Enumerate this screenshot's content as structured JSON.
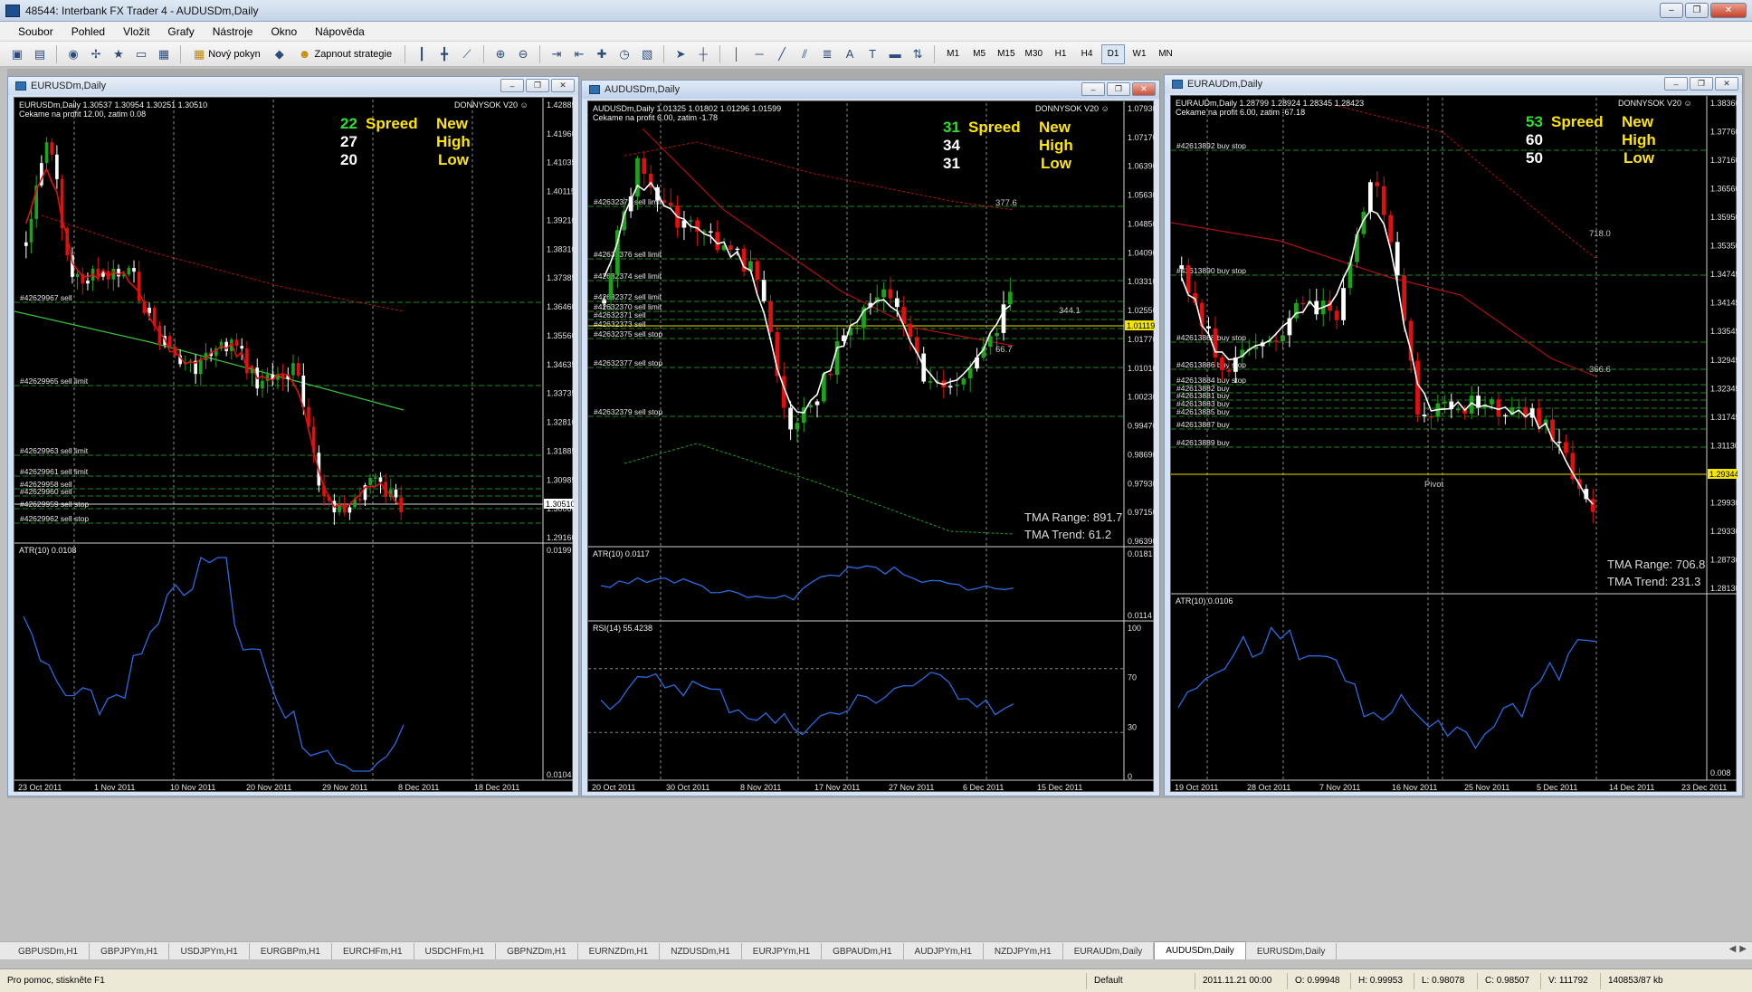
{
  "app": {
    "title": "48544: Interbank FX Trader 4 - AUDUSDm,Daily"
  },
  "window_buttons": {
    "minimize": "–",
    "restore": "❐",
    "close": "✕"
  },
  "menu": [
    "Soubor",
    "Pohled",
    "Vložit",
    "Grafy",
    "Nástroje",
    "Okno",
    "Nápověda"
  ],
  "toolbar": {
    "new_order": "Nový pokyn",
    "strategies": "Zapnout strategie",
    "timeframes": [
      "M1",
      "M5",
      "M15",
      "M30",
      "H1",
      "H4",
      "D1",
      "W1",
      "MN"
    ],
    "active_timeframe": "D1"
  },
  "charts": [
    {
      "window_title": "EURUSDm,Daily",
      "info_line1": "EURUSDm,Daily  1.30537 1.30954 1.30251 1.30510",
      "info_line2": "Cekame na profit 12.00, zatim 0.08",
      "brand": "DONNYSOK V20 ☺",
      "spread": "22",
      "spread_label": "Spreed",
      "high_val": "27",
      "high_label_new": "New",
      "high_label": "High",
      "low_val": "20",
      "low_label": "Low",
      "price_ticks": [
        "1.42885",
        "1.41960",
        "1.41035",
        "1.40115",
        "1.39210",
        "1.38310",
        "1.37385",
        "1.36460",
        "1.35560",
        "1.34635",
        "1.33735",
        "1.32810",
        "1.31885",
        "1.30985",
        "1.30060",
        "1.29160"
      ],
      "current_price": "1.30510",
      "orders": [
        "#42629967 sell",
        "#42629965 sell limit",
        "#42629963 sell limit",
        "#42629961 sell limit",
        "#42629958 sell",
        "#42629960 sell",
        "#42629959 sell stop",
        "#42629962 sell stop"
      ],
      "atr_label": "ATR(10) 0.0108",
      "atr_ticks": [
        "0.0199",
        "0.0104"
      ],
      "dates": [
        "23 Oct 2011",
        "1 Nov 2011",
        "10 Nov 2011",
        "20 Nov 2011",
        "29 Nov 2011",
        "8 Dec 2011",
        "18 Dec 2011"
      ]
    },
    {
      "window_title": "AUDUSDm,Daily",
      "info_line1": "AUDUSDm,Daily  1.01325 1.01802 1.01296 1.01599",
      "info_line2": "Cekame na profit 6.00, zatim -1.78",
      "brand": "DONNYSOK V20 ☺",
      "spread": "31",
      "spread_label": "Spreed",
      "high_val": "34",
      "high_label_new": "New",
      "high_label": "High",
      "low_val": "31",
      "low_label": "Low",
      "price_ticks": [
        "1.07930",
        "1.07170",
        "1.06390",
        "1.05630",
        "1.04850",
        "1.04090",
        "1.03310",
        "1.02550",
        "1.01770",
        "1.01010",
        "1.00230",
        "0.99470",
        "0.98690",
        "0.97930",
        "0.97150",
        "0.96390"
      ],
      "current_price": "1.01119",
      "orders": [
        "#42632371 sell limit",
        "#42632376 sell limit",
        "#42632374 sell limit",
        "#42632372 sell limit",
        "#42632370 sell limit",
        "#42632371 sell",
        "#42632373 sell",
        "#42632375 sell stop",
        "#42632377 sell stop",
        "#42632379 sell stop"
      ],
      "level_labels": [
        "377.6",
        "66.7",
        "344.1"
      ],
      "tma_range": "TMA Range: 891.7",
      "tma_trend": "TMA Trend: 61.2",
      "atr_label": "ATR(10) 0.0117",
      "atr_ticks": [
        "0.0181",
        "0.0114"
      ],
      "rsi_label": "RSI(14) 55.4238",
      "rsi_ticks": [
        "100",
        "70",
        "30",
        "0"
      ],
      "dates": [
        "20 Oct 2011",
        "30 Oct 2011",
        "8 Nov 2011",
        "17 Nov 2011",
        "27 Nov 2011",
        "6 Dec 2011",
        "15 Dec 2011"
      ]
    },
    {
      "window_title": "EURAUDm,Daily",
      "info_line1": "EURAUDm,Daily  1.28799 1.28924 1.28345 1.28423",
      "info_line2": "Cekame na profit 6.00, zatim -67.18",
      "brand": "DONNYSOK V20 ☺",
      "spread": "53",
      "spread_label": "Spreed",
      "high_val": "60",
      "high_label_new": "New",
      "high_label": "High",
      "low_val": "50",
      "low_label": "Low",
      "price_ticks": [
        "1.38360",
        "1.37760",
        "1.37160",
        "1.36560",
        "1.35950",
        "1.35350",
        "1.34745",
        "1.34145",
        "1.33545",
        "1.32945",
        "1.32345",
        "1.31745",
        "1.31130",
        "1.30530",
        "1.29930",
        "1.29330",
        "1.28730",
        "1.28130"
      ],
      "current_price": "1.29344",
      "orders": [
        "#42613892 buy stop",
        "#42613890 buy stop",
        "#42613888 buy stop",
        "#42613886 buy stop",
        "#42613884 buy stop",
        "#42613882 buy",
        "#42613881 buy",
        "#42613883 buy",
        "#42613885 buy",
        "#42613887 buy",
        "#42613889 buy"
      ],
      "level_labels": [
        "718.0",
        "366.6",
        "Pivot"
      ],
      "tma_range": "TMA Range: 706.8",
      "tma_trend": "TMA Trend: 231.3",
      "atr_label": "ATR(10) 0.0106",
      "atr_ticks": [
        "0.008"
      ],
      "dates": [
        "19 Oct 2011",
        "28 Oct 2011",
        "7 Nov 2011",
        "16 Nov 2011",
        "25 Nov 2011",
        "5 Dec 2011",
        "14 Dec 2011",
        "23 Dec 2011"
      ]
    }
  ],
  "bottom_tabs": [
    "GBPUSDm,H1",
    "GBPJPYm,H1",
    "USDJPYm,H1",
    "EURGBPm,H1",
    "EURCHFm,H1",
    "USDCHFm,H1",
    "GBPNZDm,H1",
    "EURNZDm,H1",
    "NZDUSDm,H1",
    "EURJPYm,H1",
    "GBPAUDm,H1",
    "AUDJPYm,H1",
    "NZDJPYm,H1",
    "EURAUDm,Daily",
    "AUDUSDm,Daily",
    "EURUSDm,Daily"
  ],
  "active_tab": "AUDUSDm,Daily",
  "status": {
    "help": "Pro pomoc, stiskněte F1",
    "profile": "Default",
    "datetime": "2011.11.21 00:00",
    "open": "O: 0.99948",
    "high": "H: 0.99953",
    "low": "L: 0.98078",
    "close": "C: 0.98507",
    "volume": "V: 111792",
    "traffic": "140853/87 kb"
  },
  "colors": {
    "bull": "#1fa11f",
    "bear": "#e01010",
    "neutral_candle": "#ffffff",
    "ma_white": "#ffffff",
    "ma_red": "#b01010",
    "ma_blue": "#2030c0",
    "grid": "#9a9a9a",
    "order_line": "#1f6e1f",
    "spread_green": "#2de02d",
    "label_yellow": "#ffe600",
    "atr_line": "#2a6ce0"
  }
}
